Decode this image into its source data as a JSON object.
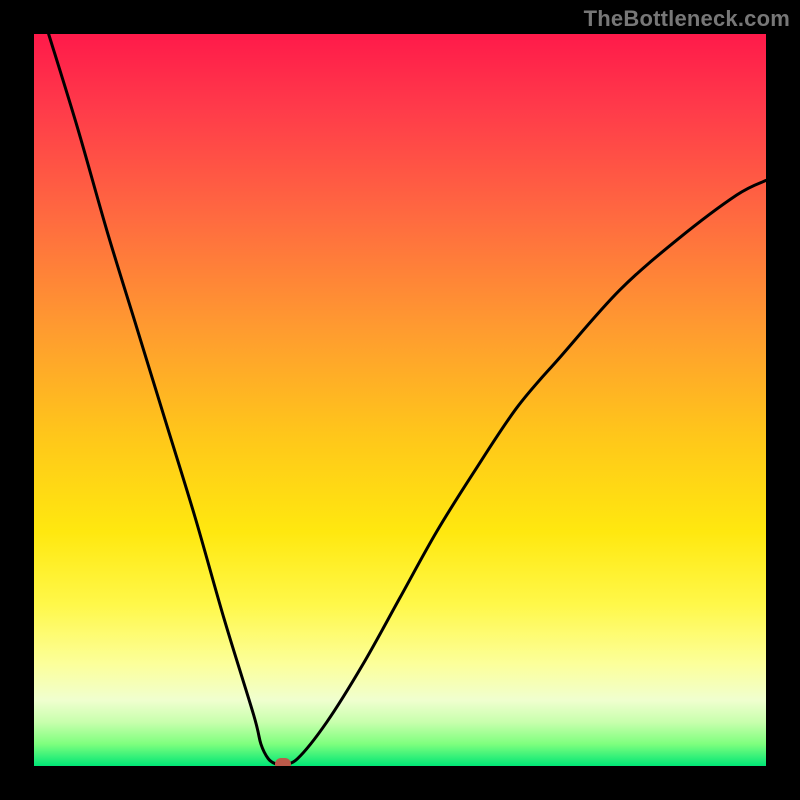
{
  "watermark": "TheBottleneck.com",
  "chart_data": {
    "type": "line",
    "title": "",
    "xlabel": "",
    "ylabel": "",
    "xlim": [
      0,
      100
    ],
    "ylim": [
      0,
      100
    ],
    "grid": false,
    "legend": false,
    "background_gradient": {
      "top_color": "#ff1a4a",
      "bottom_color": "#00e676",
      "stops": [
        {
          "pos": 0.0,
          "color": "#ff1a4a"
        },
        {
          "pos": 0.1,
          "color": "#ff3a4a"
        },
        {
          "pos": 0.25,
          "color": "#ff6a40"
        },
        {
          "pos": 0.4,
          "color": "#ff9a30"
        },
        {
          "pos": 0.55,
          "color": "#ffc71a"
        },
        {
          "pos": 0.68,
          "color": "#ffe80f"
        },
        {
          "pos": 0.78,
          "color": "#fff84a"
        },
        {
          "pos": 0.86,
          "color": "#fcff9a"
        },
        {
          "pos": 0.91,
          "color": "#f0ffcf"
        },
        {
          "pos": 0.94,
          "color": "#c8ffad"
        },
        {
          "pos": 0.97,
          "color": "#7eff7e"
        },
        {
          "pos": 1.0,
          "color": "#00e676"
        }
      ]
    },
    "series": [
      {
        "name": "bottleneck-curve",
        "x": [
          2,
          6,
          10,
          14,
          18,
          22,
          26,
          30,
          31,
          32,
          33,
          34,
          36,
          40,
          45,
          50,
          55,
          60,
          66,
          72,
          80,
          88,
          96,
          100
        ],
        "y": [
          100,
          87,
          73,
          60,
          47,
          34,
          20,
          7,
          3,
          1,
          0.3,
          0.3,
          1,
          6,
          14,
          23,
          32,
          40,
          49,
          56,
          65,
          72,
          78,
          80
        ]
      }
    ],
    "marker": {
      "x": 34,
      "y": 0.3,
      "color": "#bb5a4a"
    },
    "minimum_point": {
      "x": 33.5,
      "y": 0.3
    }
  }
}
